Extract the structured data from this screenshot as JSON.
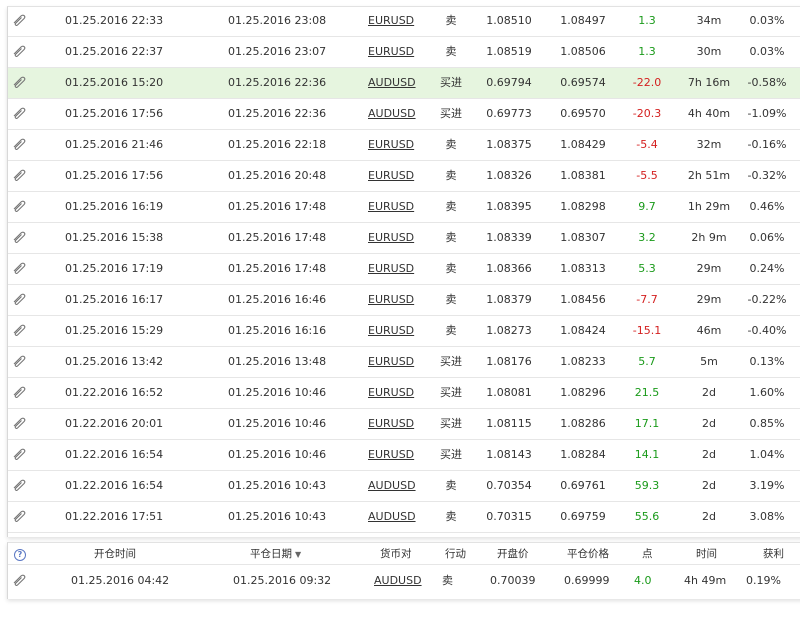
{
  "trades": [
    {
      "open": "01.25.2016 22:33",
      "close": "01.25.2016 23:08",
      "symbol": "EURUSD",
      "action": "卖",
      "open_price": "1.08510",
      "close_price": "1.08497",
      "points": "1.3",
      "duration": "34m",
      "gain": "0.03%",
      "pts_sign": "pos",
      "hl": false
    },
    {
      "open": "01.25.2016 22:37",
      "close": "01.25.2016 23:07",
      "symbol": "EURUSD",
      "action": "卖",
      "open_price": "1.08519",
      "close_price": "1.08506",
      "points": "1.3",
      "duration": "30m",
      "gain": "0.03%",
      "pts_sign": "pos",
      "hl": false
    },
    {
      "open": "01.25.2016 15:20",
      "close": "01.25.2016 22:36",
      "symbol": "AUDUSD",
      "action": "买进",
      "open_price": "0.69794",
      "close_price": "0.69574",
      "points": "-22.0",
      "duration": "7h 16m",
      "gain": "-0.58%",
      "pts_sign": "neg",
      "hl": true
    },
    {
      "open": "01.25.2016 17:56",
      "close": "01.25.2016 22:36",
      "symbol": "AUDUSD",
      "action": "买进",
      "open_price": "0.69773",
      "close_price": "0.69570",
      "points": "-20.3",
      "duration": "4h 40m",
      "gain": "-1.09%",
      "pts_sign": "neg",
      "hl": false
    },
    {
      "open": "01.25.2016 21:46",
      "close": "01.25.2016 22:18",
      "symbol": "EURUSD",
      "action": "卖",
      "open_price": "1.08375",
      "close_price": "1.08429",
      "points": "-5.4",
      "duration": "32m",
      "gain": "-0.16%",
      "pts_sign": "neg",
      "hl": false
    },
    {
      "open": "01.25.2016 17:56",
      "close": "01.25.2016 20:48",
      "symbol": "EURUSD",
      "action": "卖",
      "open_price": "1.08326",
      "close_price": "1.08381",
      "points": "-5.5",
      "duration": "2h 51m",
      "gain": "-0.32%",
      "pts_sign": "neg",
      "hl": false
    },
    {
      "open": "01.25.2016 16:19",
      "close": "01.25.2016 17:48",
      "symbol": "EURUSD",
      "action": "卖",
      "open_price": "1.08395",
      "close_price": "1.08298",
      "points": "9.7",
      "duration": "1h 29m",
      "gain": "0.46%",
      "pts_sign": "pos",
      "hl": false
    },
    {
      "open": "01.25.2016 15:38",
      "close": "01.25.2016 17:48",
      "symbol": "EURUSD",
      "action": "卖",
      "open_price": "1.08339",
      "close_price": "1.08307",
      "points": "3.2",
      "duration": "2h 9m",
      "gain": "0.06%",
      "pts_sign": "pos",
      "hl": false
    },
    {
      "open": "01.25.2016 17:19",
      "close": "01.25.2016 17:48",
      "symbol": "EURUSD",
      "action": "卖",
      "open_price": "1.08366",
      "close_price": "1.08313",
      "points": "5.3",
      "duration": "29m",
      "gain": "0.24%",
      "pts_sign": "pos",
      "hl": false
    },
    {
      "open": "01.25.2016 16:17",
      "close": "01.25.2016 16:46",
      "symbol": "EURUSD",
      "action": "卖",
      "open_price": "1.08379",
      "close_price": "1.08456",
      "points": "-7.7",
      "duration": "29m",
      "gain": "-0.22%",
      "pts_sign": "neg",
      "hl": false
    },
    {
      "open": "01.25.2016 15:29",
      "close": "01.25.2016 16:16",
      "symbol": "EURUSD",
      "action": "卖",
      "open_price": "1.08273",
      "close_price": "1.08424",
      "points": "-15.1",
      "duration": "46m",
      "gain": "-0.40%",
      "pts_sign": "neg",
      "hl": false
    },
    {
      "open": "01.25.2016 13:42",
      "close": "01.25.2016 13:48",
      "symbol": "EURUSD",
      "action": "买进",
      "open_price": "1.08176",
      "close_price": "1.08233",
      "points": "5.7",
      "duration": "5m",
      "gain": "0.13%",
      "pts_sign": "pos",
      "hl": false
    },
    {
      "open": "01.22.2016 16:52",
      "close": "01.25.2016 10:46",
      "symbol": "EURUSD",
      "action": "买进",
      "open_price": "1.08081",
      "close_price": "1.08296",
      "points": "21.5",
      "duration": "2d",
      "gain": "1.60%",
      "pts_sign": "pos",
      "hl": false
    },
    {
      "open": "01.22.2016 20:01",
      "close": "01.25.2016 10:46",
      "symbol": "EURUSD",
      "action": "买进",
      "open_price": "1.08115",
      "close_price": "1.08286",
      "points": "17.1",
      "duration": "2d",
      "gain": "0.85%",
      "pts_sign": "pos",
      "hl": false
    },
    {
      "open": "01.22.2016 16:54",
      "close": "01.25.2016 10:46",
      "symbol": "EURUSD",
      "action": "买进",
      "open_price": "1.08143",
      "close_price": "1.08284",
      "points": "14.1",
      "duration": "2d",
      "gain": "1.04%",
      "pts_sign": "pos",
      "hl": false
    },
    {
      "open": "01.22.2016 16:54",
      "close": "01.25.2016 10:43",
      "symbol": "AUDUSD",
      "action": "卖",
      "open_price": "0.70354",
      "close_price": "0.69761",
      "points": "59.3",
      "duration": "2d",
      "gain": "3.19%",
      "pts_sign": "pos",
      "hl": false
    },
    {
      "open": "01.22.2016 17:51",
      "close": "01.25.2016 10:43",
      "symbol": "AUDUSD",
      "action": "卖",
      "open_price": "0.70315",
      "close_price": "0.69759",
      "points": "55.6",
      "duration": "2d",
      "gain": "3.08%",
      "pts_sign": "pos",
      "hl": false
    }
  ],
  "second_table": {
    "headers": {
      "help_icon": "?",
      "open_time": "开仓时间",
      "close_date": "平仓日期",
      "symbol": "货币对",
      "action": "行动",
      "open_price": "开盘价",
      "close_price": "平仓价格",
      "points": "点",
      "duration": "时间",
      "gain": "获利"
    },
    "row": {
      "open": "01.25.2016 04:42",
      "close": "01.25.2016 09:32",
      "symbol": "AUDUSD",
      "action": "卖",
      "open_price": "0.70039",
      "close_price": "0.69999",
      "points": "4.0",
      "duration": "4h 49m",
      "gain": "0.19%",
      "pts_sign": "pos"
    }
  },
  "icons": {
    "row_icon": "paperclip-icon",
    "sort_icon": "sort-desc-icon"
  },
  "colors": {
    "positive": "#1a9a1a",
    "negative": "#d42020",
    "highlight_row": "#e6f5df"
  }
}
